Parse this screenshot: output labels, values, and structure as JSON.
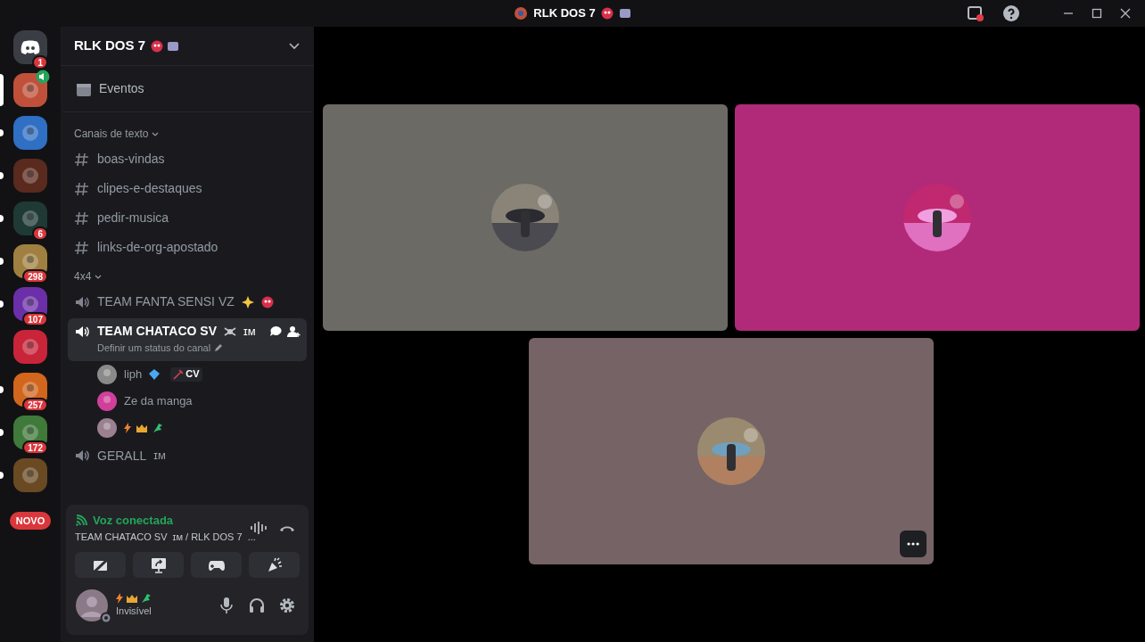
{
  "window": {
    "title": "RLK DOS 7"
  },
  "servers": [
    {
      "color": "#3b3d44",
      "badge": "1",
      "kind": "home",
      "selected": false,
      "unread": false
    },
    {
      "color": "#c0503a",
      "kind": "server",
      "selected": true,
      "voice": true
    },
    {
      "color": "#2f6fc4",
      "kind": "server",
      "selected": false,
      "unread": true
    },
    {
      "color": "#5a2a1e",
      "kind": "server",
      "selected": false,
      "unread": true
    },
    {
      "color": "#1f3a34",
      "badge": "6",
      "kind": "server",
      "selected": false,
      "unread": true
    },
    {
      "color": "#a08040",
      "badge": "298",
      "kind": "server",
      "selected": false,
      "unread": true
    },
    {
      "color": "#6b2fa8",
      "badge": "107",
      "kind": "server",
      "selected": false,
      "unread": true
    },
    {
      "color": "#c8243a",
      "kind": "server",
      "selected": false,
      "unread": false
    },
    {
      "color": "#d2661c",
      "badge": "257",
      "kind": "server",
      "selected": false,
      "unread": true
    },
    {
      "color": "#3f7a3a",
      "badge": "172",
      "kind": "server",
      "selected": false,
      "unread": true
    },
    {
      "color": "#6a4a22",
      "kind": "server",
      "selected": false,
      "unread": true
    },
    {
      "badge": "NOVO",
      "kind": "new",
      "selected": false,
      "unread": false
    }
  ],
  "server_name": "RLK DOS 7",
  "events": "Eventos",
  "categories": [
    {
      "name": "Canais de texto",
      "channels": [
        {
          "kind": "text",
          "name": "boas-vindas",
          "selected": false
        },
        {
          "kind": "text",
          "name": "clipes-e-destaques",
          "selected": false
        },
        {
          "kind": "text",
          "name": "pedir-musica",
          "selected": false
        },
        {
          "kind": "text",
          "name": "links-de-org-apostado",
          "selected": false
        }
      ]
    },
    {
      "name": "4x4",
      "channels": [
        {
          "kind": "voice",
          "name": "TEAM FANTA SENSI VZ",
          "selected": false,
          "emoji": true
        },
        {
          "kind": "voice",
          "name": "TEAM CHATACO SV",
          "suffix": "ɪᴍ",
          "selected": true,
          "status": "Definir um status do canal",
          "members": [
            {
              "name": "liph",
              "color": "#8a8a8a",
              "tag": "CV"
            },
            {
              "name": "Ze da manga",
              "color": "#d0409a"
            },
            {
              "color": "#9a8090",
              "emojis": true
            }
          ]
        },
        {
          "kind": "voice",
          "name": "GERALL",
          "suffix": "ɪᴍ",
          "selected": false
        }
      ]
    }
  ],
  "voice_panel": {
    "status": "Voz conectada",
    "channel": "TEAM CHATACO SV",
    "suffix": "ɪᴍ / RLK DOS 7",
    "ellipsis": "..."
  },
  "user": {
    "status": "Invisível"
  },
  "tiles": [
    {
      "color": "#6b6a64"
    },
    {
      "color": "#b12a7a"
    },
    {
      "color": "#756365",
      "more": true
    }
  ]
}
